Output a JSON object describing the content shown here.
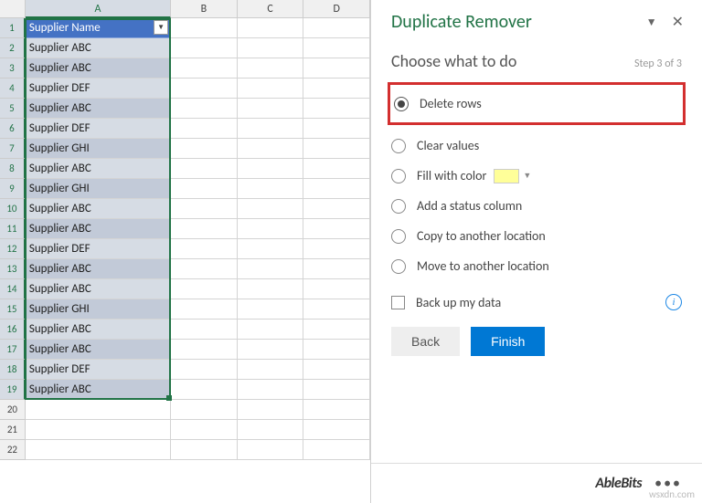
{
  "columns": [
    "A",
    "B",
    "C",
    "D"
  ],
  "grid": {
    "header": "Supplier Name",
    "rows": [
      "Supplier ABC",
      "Supplier ABC",
      "Supplier DEF",
      "Supplier ABC",
      "Supplier DEF",
      "Supplier GHI",
      "Supplier ABC",
      "Supplier GHI",
      "Supplier ABC",
      "Supplier ABC",
      "Supplier DEF",
      "Supplier ABC",
      "Supplier ABC",
      "Supplier GHI",
      "Supplier ABC",
      "Supplier ABC",
      "Supplier DEF",
      "Supplier ABC"
    ],
    "empty_rows": [
      20,
      21,
      22
    ]
  },
  "pane": {
    "title": "Duplicate Remover",
    "step_title": "Choose what to do",
    "step_label": "Step 3 of 3",
    "options": {
      "delete": "Delete rows",
      "clear": "Clear values",
      "fill": "Fill with color",
      "status": "Add a status column",
      "copy": "Copy to another location",
      "move": "Move to another location"
    },
    "backup": "Back up my data",
    "back_btn": "Back",
    "finish_btn": "Finish",
    "brand": "AbleBits"
  },
  "watermark": "wsxdn.com"
}
